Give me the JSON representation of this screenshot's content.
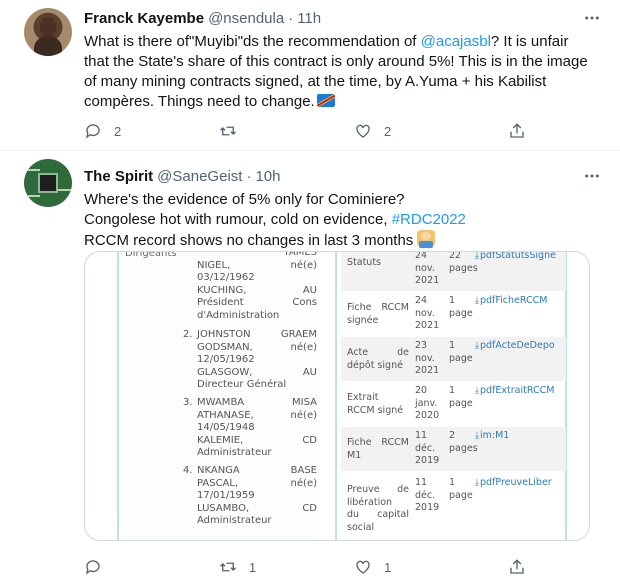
{
  "tweets": [
    {
      "name": "Franck Kayembe",
      "handle": "@nsendula",
      "time": "11h",
      "text_parts": [
        "What is there of\"Muyibi\"ds the recommendation of ",
        "@acajasbl",
        "? It is unfair that the State's share of this contract is only around 5%! This is in the image of many mining contracts signed, at the time, by A.Yuma + his Kabilist compères. Things need to change."
      ],
      "reply_count": "2",
      "retweet_count": "",
      "like_count": "2",
      "icons": {
        "avatar": "avatar-photo",
        "flag": "drc-flag-emoji"
      }
    },
    {
      "name": "The Spirit",
      "handle": "@SaneGeist",
      "time": "10h",
      "line1": "Where's the evidence of 5% only for Cominiere?",
      "line2_prefix": "Congolese hot with rumour, cold on evidence, ",
      "line2_link": "#RDC2022",
      "line3": "RCCM record shows no changes in last 3 months",
      "reply_count": "",
      "retweet_count": "1",
      "like_count": "1",
      "icons": {
        "avatar": "circuit-chip-avatar",
        "emoji": "man-technologist-emoji"
      }
    }
  ],
  "document": {
    "left_header": "Dirigeants",
    "people": [
      {
        "num": "",
        "lines": [
          [
            "",
            "TAMES"
          ],
          [
            "NIGEL,",
            "né(e)"
          ],
          [
            "03/12/1962",
            ""
          ],
          [
            "KUCHING,",
            "AU"
          ],
          [
            "Président",
            "Cons"
          ],
          [
            "d'Administration",
            ""
          ]
        ]
      },
      {
        "num": "2.",
        "lines": [
          [
            "JOHNSTON",
            "GRAEM"
          ],
          [
            "GODSMAN,",
            "né(e)"
          ],
          [
            "12/05/1962",
            ""
          ],
          [
            "GLASGOW,",
            "AU"
          ],
          [
            "Directeur Général",
            ""
          ]
        ]
      },
      {
        "num": "3.",
        "lines": [
          [
            "MWAMBA",
            "MISA"
          ],
          [
            "ATHANASE,",
            "né(e)"
          ],
          [
            "14/05/1948",
            ""
          ],
          [
            "KALEMIE,",
            "CD"
          ],
          [
            "Administrateur",
            ""
          ]
        ]
      },
      {
        "num": "4.",
        "lines": [
          [
            "NKANGA",
            "BASE"
          ],
          [
            "PASCAL,",
            "né(e)"
          ],
          [
            "17/01/1959",
            ""
          ],
          [
            "LUSAMBO,",
            "CD"
          ],
          [
            "Administrateur",
            ""
          ]
        ]
      }
    ],
    "records": [
      {
        "label": [
          [
            "Statuts",
            ""
          ]
        ],
        "date": [
          "24",
          "nov.",
          "2021"
        ],
        "pages": [
          "22",
          "pages"
        ],
        "link": "pdfStatutsSigne",
        "shade": true
      },
      {
        "label": [
          [
            "Fiche",
            "RCCM"
          ],
          [
            "signée",
            ""
          ]
        ],
        "date": [
          "24",
          "nov.",
          "2021"
        ],
        "pages": [
          "1",
          "page"
        ],
        "link": "pdfFicheRCCM",
        "shade": false
      },
      {
        "label": [
          [
            "Acte",
            "de"
          ],
          [
            "dépôt signé",
            ""
          ]
        ],
        "date": [
          "23",
          "nov.",
          "2021"
        ],
        "pages": [
          "1",
          "page"
        ],
        "link": "pdfActeDeDepo",
        "shade": true
      },
      {
        "label": [
          [
            "Extrait",
            ""
          ],
          [
            "RCCM signé",
            ""
          ]
        ],
        "date": [
          "20",
          "janv.",
          "2020"
        ],
        "pages": [
          "1",
          "page"
        ],
        "link": "pdfExtraitRCCM",
        "shade": false
      },
      {
        "label": [
          [
            "Fiche",
            "RCCM"
          ],
          [
            "M1",
            ""
          ]
        ],
        "date": [
          "11",
          "déc.",
          "2019"
        ],
        "pages": [
          "2",
          "pages"
        ],
        "link": "im:M1",
        "shade": true
      },
      {
        "label": [
          [
            "Preuve",
            "de"
          ],
          [
            "libération",
            ""
          ],
          [
            "du",
            "capital"
          ],
          [
            "social",
            ""
          ]
        ],
        "date": [
          "11",
          "déc.",
          "2019"
        ],
        "pages": [
          "1",
          "page"
        ],
        "link": "pdfPreuveLiber",
        "shade": false
      }
    ]
  }
}
